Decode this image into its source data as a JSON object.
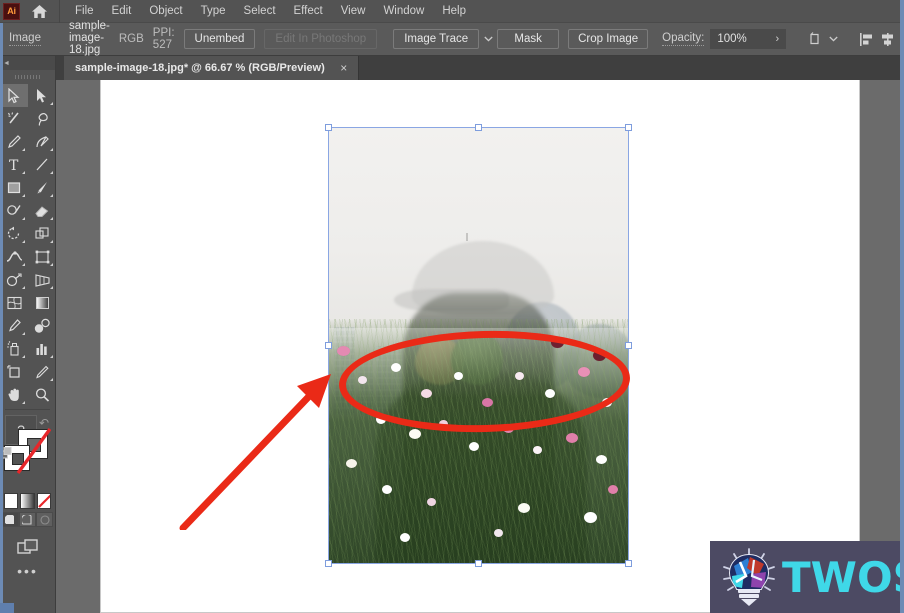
{
  "app": {
    "name": "Adobe Illustrator",
    "logo_text": "Ai",
    "home_icon": "home-icon"
  },
  "menubar": {
    "items": [
      {
        "label": "File"
      },
      {
        "label": "Edit"
      },
      {
        "label": "Object"
      },
      {
        "label": "Type"
      },
      {
        "label": "Select"
      },
      {
        "label": "Effect"
      },
      {
        "label": "View"
      },
      {
        "label": "Window"
      },
      {
        "label": "Help"
      }
    ]
  },
  "controlbar": {
    "context_label": "Image",
    "file_name": "sample-image-18.jpg",
    "color_mode": "RGB",
    "ppi": "PPI: 527",
    "unembed_label": "Unembed",
    "edit_in_photoshop_label": "Edit In Photoshop",
    "edit_in_photoshop_enabled": false,
    "image_trace_label": "Image Trace",
    "image_trace_chevron": "chevron-down-icon",
    "mask_label": "Mask",
    "crop_image_label": "Crop Image",
    "opacity_label": "Opacity:",
    "opacity_value": "100%",
    "opacity_arrow": "chevron-right-icon",
    "transform_icon": "transform-icon",
    "align_icons": [
      "align-left-icon",
      "align-center-horizontal-icon",
      "align-right-icon",
      "align-top-icon"
    ]
  },
  "tabbar": {
    "tabs": [
      {
        "label": "sample-image-18.jpg* @ 66.67 % (RGB/Preview)",
        "close_label": "×",
        "active": true
      }
    ]
  },
  "toolpanel": {
    "collapse_icon": "collapse-panel-icon",
    "grip": "panel-grip",
    "tools": [
      {
        "name": "selection-tool",
        "glyph": "arrow-white",
        "has_corner": false,
        "selected": true
      },
      {
        "name": "direct-selection-tool",
        "glyph": "arrow-black",
        "has_corner": true
      },
      {
        "name": "magic-wand-tool",
        "glyph": "wand",
        "has_corner": false
      },
      {
        "name": "lasso-tool",
        "glyph": "lasso",
        "has_corner": false
      },
      {
        "name": "pen-tool",
        "glyph": "pen",
        "has_corner": true
      },
      {
        "name": "curvature-tool",
        "glyph": "curvature",
        "has_corner": false
      },
      {
        "name": "type-tool",
        "glyph": "type",
        "has_corner": true
      },
      {
        "name": "line-segment-tool",
        "glyph": "line",
        "has_corner": true
      },
      {
        "name": "rectangle-tool",
        "glyph": "rectangle",
        "has_corner": true
      },
      {
        "name": "paintbrush-tool",
        "glyph": "brush",
        "has_corner": true
      },
      {
        "name": "shaper-tool",
        "glyph": "shaper",
        "has_corner": true
      },
      {
        "name": "eraser-tool",
        "glyph": "eraser",
        "has_corner": true
      },
      {
        "name": "rotate-tool",
        "glyph": "rotate",
        "has_corner": true
      },
      {
        "name": "scale-tool",
        "glyph": "scale",
        "has_corner": true
      },
      {
        "name": "width-tool",
        "glyph": "width",
        "has_corner": true
      },
      {
        "name": "free-transform-tool",
        "glyph": "free-transform",
        "has_corner": true
      },
      {
        "name": "shape-builder-tool",
        "glyph": "shape-builder",
        "has_corner": true
      },
      {
        "name": "perspective-grid-tool",
        "glyph": "perspective",
        "has_corner": true
      },
      {
        "name": "mesh-tool",
        "glyph": "mesh",
        "has_corner": false
      },
      {
        "name": "gradient-tool",
        "glyph": "gradient",
        "has_corner": false
      },
      {
        "name": "eyedropper-tool",
        "glyph": "eyedropper",
        "has_corner": true
      },
      {
        "name": "blend-tool",
        "glyph": "blend",
        "has_corner": false
      },
      {
        "name": "symbol-sprayer-tool",
        "glyph": "symbol-sprayer",
        "has_corner": true
      },
      {
        "name": "column-graph-tool",
        "glyph": "graph",
        "has_corner": true
      },
      {
        "name": "artboard-tool",
        "glyph": "artboard",
        "has_corner": false
      },
      {
        "name": "slice-tool",
        "glyph": "slice",
        "has_corner": true
      },
      {
        "name": "hand-tool",
        "glyph": "hand",
        "has_corner": true
      },
      {
        "name": "zoom-tool",
        "glyph": "zoom",
        "has_corner": false
      }
    ],
    "help_label": "?",
    "reset_label": "↶",
    "fill_color": "#ffffff",
    "stroke_color": "none",
    "color_modes": [
      "color-swatch-mode",
      "gradient-mode",
      "none-mode"
    ],
    "draw_modes": [
      "draw-normal-mode",
      "draw-behind-mode",
      "draw-inside-mode"
    ],
    "screen_mode_icon": "screen-mode-icon",
    "more_tools_label": "•••"
  },
  "annotations": {
    "ellipse_color": "#ea2a17",
    "arrow_color": "#ea2a17",
    "ellipse_name": "red-highlight-ellipse",
    "arrow_name": "red-pointer-arrow"
  },
  "watermark": {
    "text": "TWOS",
    "accent_color": "#3fd8e8",
    "background_color": "#4c4a63",
    "icon": "lightbulb-icon"
  },
  "artwork": {
    "description": "double-exposure-photo-person-silhouette-with-cap-over-cosmos-flower-field-and-city-skyline"
  }
}
